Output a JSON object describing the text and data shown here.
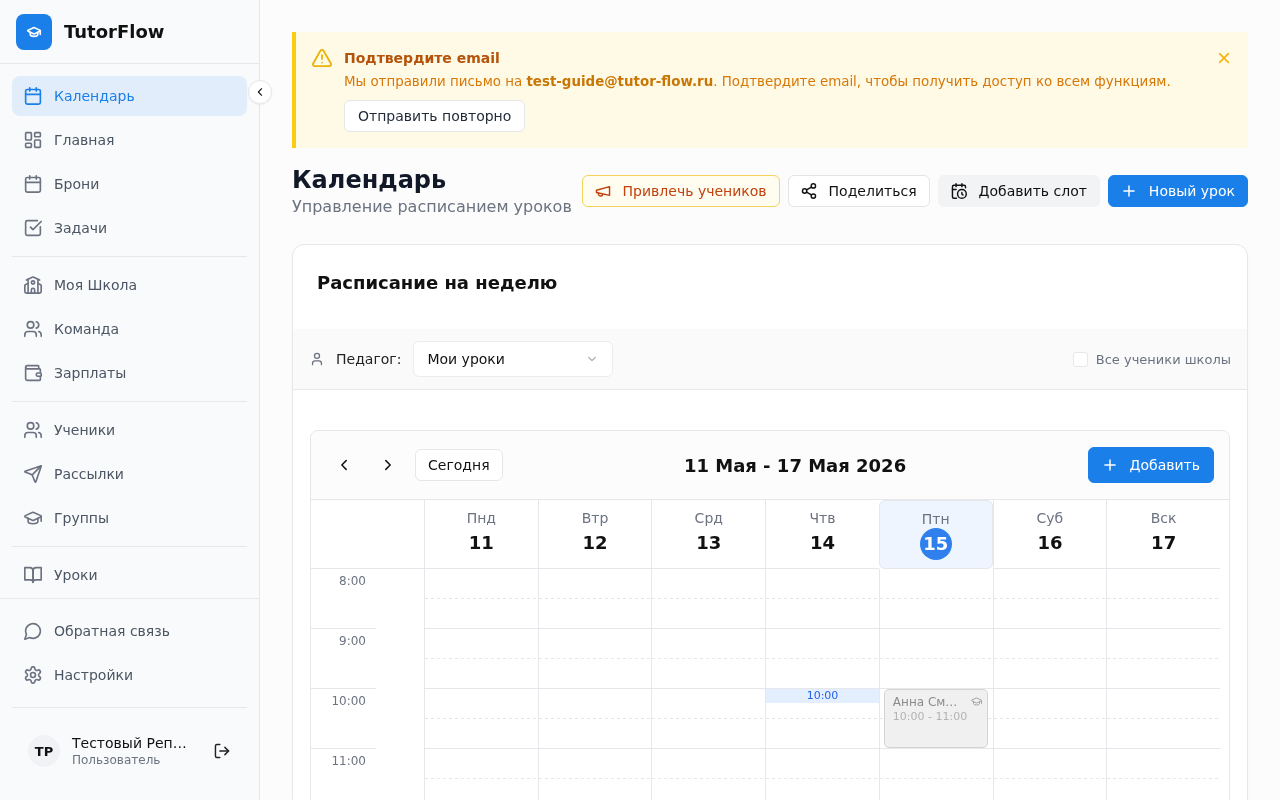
{
  "sidebar": {
    "brand": "TutorFlow",
    "nav_groups": [
      {
        "items": [
          {
            "label": "Календарь",
            "selected": true
          },
          {
            "label": "Главная",
            "selected": false
          },
          {
            "label": "Брони",
            "selected": false
          },
          {
            "label": "Задачи",
            "selected": false
          }
        ]
      },
      {
        "items": [
          {
            "label": "Моя Школа",
            "selected": false
          },
          {
            "label": "Команда",
            "selected": false
          },
          {
            "label": "Зарплаты",
            "selected": false
          }
        ]
      },
      {
        "items": [
          {
            "label": "Ученики",
            "selected": false
          },
          {
            "label": "Рассылки",
            "selected": false
          },
          {
            "label": "Группы",
            "selected": false
          }
        ]
      },
      {
        "items": [
          {
            "label": "Уроки",
            "selected": false
          }
        ]
      }
    ],
    "footer_items": [
      {
        "label": "Обратная связь",
        "selected": false
      },
      {
        "label": "Настройки",
        "selected": false
      }
    ],
    "user": {
      "initials": "ТР",
      "name": "Тестовый Реп…",
      "role": "Пользователь"
    }
  },
  "alert": {
    "title": "Подтвердите email",
    "message": "Мы отправили письмо на **test-guide@tutor-flow.ru**. Подтвердите email, чтобы получить доступ ко всем функциям.",
    "button": "Отправить повторно"
  },
  "header": {
    "title": "Календарь",
    "subtitle": "Управление расписанием уроков",
    "actions": [
      {
        "label": "Привлечь учеников",
        "kind": "promo"
      },
      {
        "label": "Поделиться",
        "kind": "outline"
      },
      {
        "label": "Добавить слот",
        "kind": "soft"
      },
      {
        "label": "Новый урок",
        "kind": "primary"
      }
    ]
  },
  "schedule": {
    "title": "Расписание на неделю",
    "filter": {
      "label": "Педагог:",
      "value": "Мои уроки",
      "all_students": {
        "label": "Все ученики школы",
        "checked": false
      }
    },
    "calendar": {
      "today_button": "Сегодня",
      "range": "11 Мая - 17 Мая 2026",
      "add_button": "Добавить",
      "days": [
        {
          "name": "Пнд",
          "date": "11",
          "selected": false
        },
        {
          "name": "Втр",
          "date": "12",
          "selected": false
        },
        {
          "name": "Срд",
          "date": "13",
          "selected": false
        },
        {
          "name": "Чтв",
          "date": "14",
          "selected": false
        },
        {
          "name": "Птн",
          "date": "15",
          "selected": true
        },
        {
          "name": "Суб",
          "date": "16",
          "selected": false
        },
        {
          "name": "Вск",
          "date": "17",
          "selected": false
        }
      ],
      "rows": [
        {
          "time": "8:00",
          "cells": [
            {
              "kind": "empty"
            },
            {
              "kind": "empty"
            },
            {
              "kind": "empty"
            },
            {
              "kind": "empty"
            },
            {
              "kind": "empty"
            },
            {
              "kind": "empty"
            },
            {
              "kind": "empty"
            }
          ]
        },
        {
          "time": "9:00",
          "cells": [
            {
              "kind": "empty"
            },
            {
              "kind": "empty"
            },
            {
              "kind": "empty"
            },
            {
              "kind": "empty"
            },
            {
              "kind": "empty"
            },
            {
              "kind": "empty"
            },
            {
              "kind": "empty"
            }
          ]
        },
        {
          "time": "10:00",
          "cells": [
            {
              "kind": "empty"
            },
            {
              "kind": "empty"
            },
            {
              "kind": "empty"
            },
            {
              "kind": "now",
              "label": "10:00"
            },
            {
              "kind": "event",
              "title": "Анна См…",
              "time": "10:00 - 11:00"
            },
            {
              "kind": "empty"
            },
            {
              "kind": "empty"
            }
          ]
        },
        {
          "time": "11:00",
          "cells": [
            {
              "kind": "empty"
            },
            {
              "kind": "empty"
            },
            {
              "kind": "empty"
            },
            {
              "kind": "empty"
            },
            {
              "kind": "empty"
            },
            {
              "kind": "empty"
            },
            {
              "kind": "empty"
            }
          ]
        }
      ]
    }
  }
}
